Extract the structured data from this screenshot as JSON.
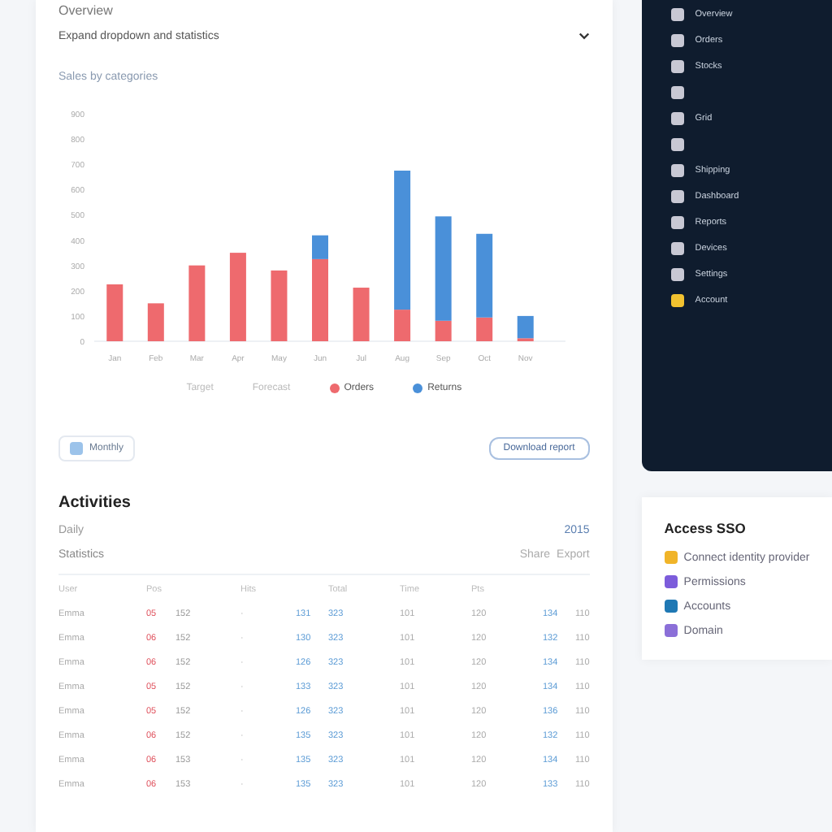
{
  "page_title": "Overview",
  "panel": {
    "heading": "Expand dropdown and statistics",
    "expanded": true,
    "subtitle": "Sales by categories"
  },
  "chart_data": {
    "type": "bar",
    "stacked": true,
    "categories": [
      "Jan",
      "Feb",
      "Mar",
      "Apr",
      "May",
      "Jun",
      "Jul",
      "Aug",
      "Sep",
      "Oct",
      "Nov"
    ],
    "yticks": [
      0,
      100,
      200,
      300,
      400,
      500,
      600,
      700,
      800,
      900
    ],
    "ylim": [
      0,
      900
    ],
    "series": [
      {
        "name": "Orders",
        "color": "#ee6a6e",
        "values": [
          225,
          150,
          300,
          350,
          280,
          325,
          212,
          125,
          81,
          94,
          12
        ]
      },
      {
        "name": "Returns",
        "color": "#4a90d9",
        "values": [
          0,
          0,
          0,
          0,
          0,
          94,
          0,
          550,
          413,
          331,
          88
        ]
      }
    ]
  },
  "inactive_legend": [
    "Target",
    "Forecast"
  ],
  "filter_chip": {
    "label": "Monthly"
  },
  "report_button": "Download report",
  "activities": {
    "title": "Activities",
    "daily_label": "Daily",
    "daily_value": "2015",
    "stats_label": "Statistics",
    "stats_actions": [
      "Share",
      "Export"
    ],
    "columns": [
      "User",
      "Pos",
      null,
      "Hits",
      null,
      "Total",
      "Time",
      "Pts",
      null
    ],
    "rows": [
      [
        "Emma",
        "05",
        "152",
        "·",
        "131",
        "323",
        "101",
        "120",
        "134",
        "110"
      ],
      [
        "Emma",
        "06",
        "152",
        "·",
        "130",
        "323",
        "101",
        "120",
        "132",
        "110"
      ],
      [
        "Emma",
        "06",
        "152",
        "·",
        "126",
        "323",
        "101",
        "120",
        "134",
        "110"
      ],
      [
        "Emma",
        "05",
        "152",
        "·",
        "133",
        "323",
        "101",
        "120",
        "134",
        "110"
      ],
      [
        "Emma",
        "05",
        "152",
        "·",
        "126",
        "323",
        "101",
        "120",
        "136",
        "110"
      ],
      [
        "Emma",
        "06",
        "152",
        "·",
        "135",
        "323",
        "101",
        "120",
        "132",
        "110"
      ],
      [
        "Emma",
        "06",
        "153",
        "·",
        "135",
        "323",
        "101",
        "120",
        "134",
        "110"
      ],
      [
        "Emma",
        "06",
        "153",
        "·",
        "135",
        "323",
        "101",
        "120",
        "133",
        "110"
      ]
    ]
  },
  "sidebar": {
    "items": [
      {
        "label": "Overview",
        "kind": "plain"
      },
      {
        "label": "Orders",
        "kind": "plain"
      },
      {
        "label": "Stocks",
        "kind": "plain"
      },
      {
        "kind": "plain"
      },
      {
        "label": "Grid",
        "kind": "plain"
      },
      {
        "kind": "plain"
      },
      {
        "label": "Shipping",
        "kind": "plain"
      },
      {
        "label": "Dashboard",
        "kind": "plain"
      },
      {
        "label": "Reports",
        "kind": "plain"
      },
      {
        "label": "Devices",
        "kind": "plain"
      },
      {
        "label": "Settings",
        "kind": "plain"
      },
      {
        "label": "Account",
        "kind": "accent"
      }
    ]
  },
  "sso": {
    "title": "Access SSO",
    "items": [
      {
        "label": "Connect identity provider",
        "color": "#f0b429"
      },
      {
        "label": "Permissions",
        "color": "#7c5cdb"
      },
      {
        "label": "Accounts",
        "color": "#1f78b4"
      },
      {
        "label": "Domain",
        "color": "#8b6fd8"
      }
    ]
  }
}
